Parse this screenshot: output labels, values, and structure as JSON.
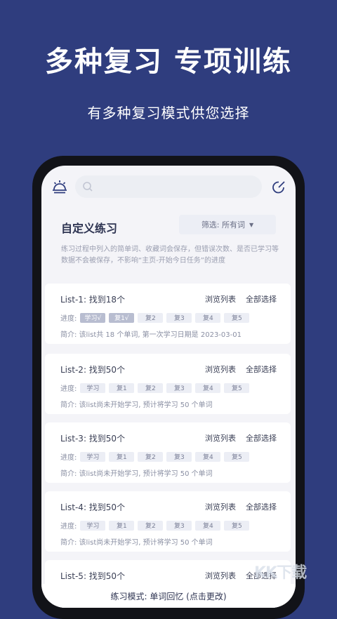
{
  "hero": {
    "title": "多种复习  专项训练",
    "subtitle": "有多种复习模式供您选择"
  },
  "topbar": {
    "left_icon": "alarm-icon",
    "search_icon": "search-icon",
    "right_icon": "edit-icon"
  },
  "page": {
    "title": "自定义练习",
    "filter_label": "筛选: 所有词",
    "filter_arrow": "▼",
    "description": "练习过程中列入的简单词、收藏词会保存，但错误次数、是否已学习等数据不会被保存，不影响“主页-开始今日任务”的进度"
  },
  "lists": [
    {
      "title": "List-1: 找到18个",
      "browse": "浏览列表",
      "select_all": "全部选择",
      "progress_label": "进度:",
      "stages": [
        {
          "label": "学习√",
          "done": true
        },
        {
          "label": "复1√",
          "done": true
        },
        {
          "label": "复2",
          "done": false
        },
        {
          "label": "复3",
          "done": false
        },
        {
          "label": "复4",
          "done": false
        },
        {
          "label": "复5",
          "done": false
        }
      ],
      "note": "简介: 该list共 18 个单词, 第一次学习日期是 2023-03-01"
    },
    {
      "title": "List-2: 找到50个",
      "browse": "浏览列表",
      "select_all": "全部选择",
      "progress_label": "进度:",
      "stages": [
        {
          "label": "学习",
          "done": false
        },
        {
          "label": "复1",
          "done": false
        },
        {
          "label": "复2",
          "done": false
        },
        {
          "label": "复3",
          "done": false
        },
        {
          "label": "复4",
          "done": false
        },
        {
          "label": "复5",
          "done": false
        }
      ],
      "note": "简介: 该list尚未开始学习, 预计将学习 50 个单词"
    },
    {
      "title": "List-3: 找到50个",
      "browse": "浏览列表",
      "select_all": "全部选择",
      "progress_label": "进度:",
      "stages": [
        {
          "label": "学习",
          "done": false
        },
        {
          "label": "复1",
          "done": false
        },
        {
          "label": "复2",
          "done": false
        },
        {
          "label": "复3",
          "done": false
        },
        {
          "label": "复4",
          "done": false
        },
        {
          "label": "复5",
          "done": false
        }
      ],
      "note": "简介: 该list尚未开始学习, 预计将学习 50 个单词"
    },
    {
      "title": "List-4: 找到50个",
      "browse": "浏览列表",
      "select_all": "全部选择",
      "progress_label": "进度:",
      "stages": [
        {
          "label": "学习",
          "done": false
        },
        {
          "label": "复1",
          "done": false
        },
        {
          "label": "复2",
          "done": false
        },
        {
          "label": "复3",
          "done": false
        },
        {
          "label": "复4",
          "done": false
        },
        {
          "label": "复5",
          "done": false
        }
      ],
      "note": "简介: 该list尚未开始学习, 预计将学习 50 个单词"
    },
    {
      "title": "List-5: 找到50个",
      "browse": "浏览列表",
      "select_all": "全部选择"
    }
  ],
  "bottom": {
    "mode_text": "练习模式: 单词回忆 (点击更改)"
  },
  "watermark": "KK下载",
  "colors": {
    "background": "#2f3d7e",
    "chip_done": "#b8bdd0",
    "chip": "#eceef5"
  }
}
